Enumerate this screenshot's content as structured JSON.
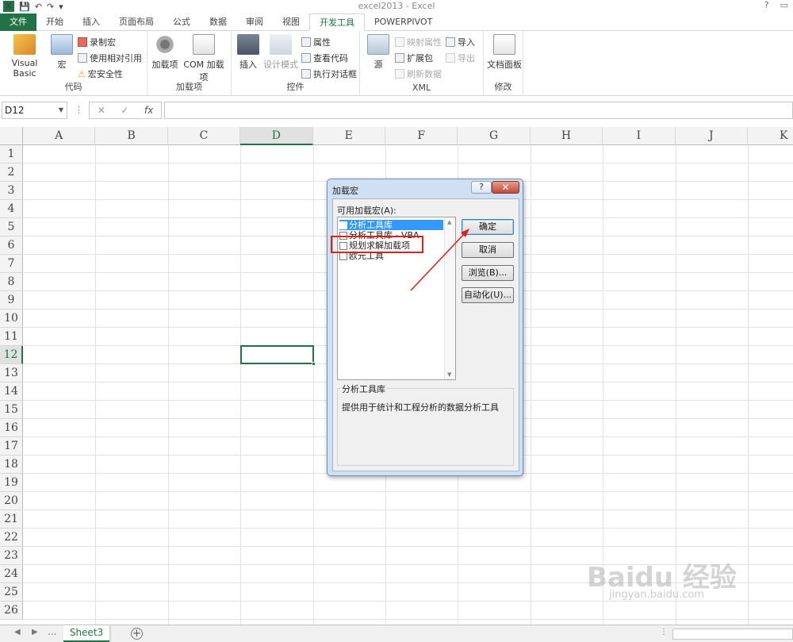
{
  "window": {
    "title": "excel2013 - Excel",
    "help": "?",
    "restore": "▭",
    "logo": "X"
  },
  "tabs": [
    "文件",
    "开始",
    "插入",
    "页面布局",
    "公式",
    "数据",
    "审阅",
    "视图",
    "开发工具",
    "POWERPIVOT"
  ],
  "active_tab_index": 8,
  "ribbon": {
    "code": {
      "label": "代码",
      "vb": "Visual Basic",
      "macro": "宏",
      "record": "录制宏",
      "relative": "使用相对引用",
      "security": "宏安全性"
    },
    "addins": {
      "label": "加载项",
      "addins": "加载项",
      "com": "COM 加载项"
    },
    "controls": {
      "label": "控件",
      "insert": "插入",
      "design": "设计模式",
      "properties": "属性",
      "view_code": "查看代码",
      "run_dialog": "执行对话框"
    },
    "xml": {
      "label": "XML",
      "source": "源",
      "map_props": "映射属性",
      "expansion": "扩展包",
      "refresh": "刷新数据",
      "import": "导入",
      "export": "导出"
    },
    "modify": {
      "label": "修改",
      "doc_panel": "文档面板"
    }
  },
  "formula_bar": {
    "name_box": "D12",
    "cancel": "✕",
    "enter": "✓",
    "fx": "fx",
    "formula": ""
  },
  "sheet": {
    "columns": [
      "A",
      "B",
      "C",
      "D",
      "E",
      "F",
      "G",
      "H",
      "I",
      "J",
      "K"
    ],
    "rows": [
      "1",
      "2",
      "3",
      "4",
      "5",
      "6",
      "7",
      "8",
      "9",
      "10",
      "11",
      "12",
      "13",
      "14",
      "15",
      "16",
      "17",
      "18",
      "19",
      "20",
      "21",
      "22",
      "23",
      "24",
      "25",
      "26"
    ],
    "selected_cell": "D12"
  },
  "sheet_tabs": {
    "active": "Sheet3",
    "more": "...",
    "add": "+"
  },
  "dialog": {
    "title": "加载宏",
    "help": "?",
    "close": "✕",
    "list_label": "可用加载宏(A):",
    "items": [
      "分析工具库",
      "分析工具库 - VBA",
      "规划求解加载项",
      "欧元工具"
    ],
    "selected_index": 0,
    "highlighted_item": "规划求解加载项",
    "buttons": {
      "ok": "确定",
      "cancel": "取消",
      "browse": "浏览(B)...",
      "automation": "自动化(U)..."
    },
    "desc_title": "分析工具库",
    "desc_text": "提供用于统计和工程分析的数据分析工具"
  },
  "watermark": {
    "main": "Baidu 经验",
    "sub": "jingyan.baidu.com"
  },
  "colors": {
    "accent": "#217346",
    "annotation": "#e0211b"
  }
}
